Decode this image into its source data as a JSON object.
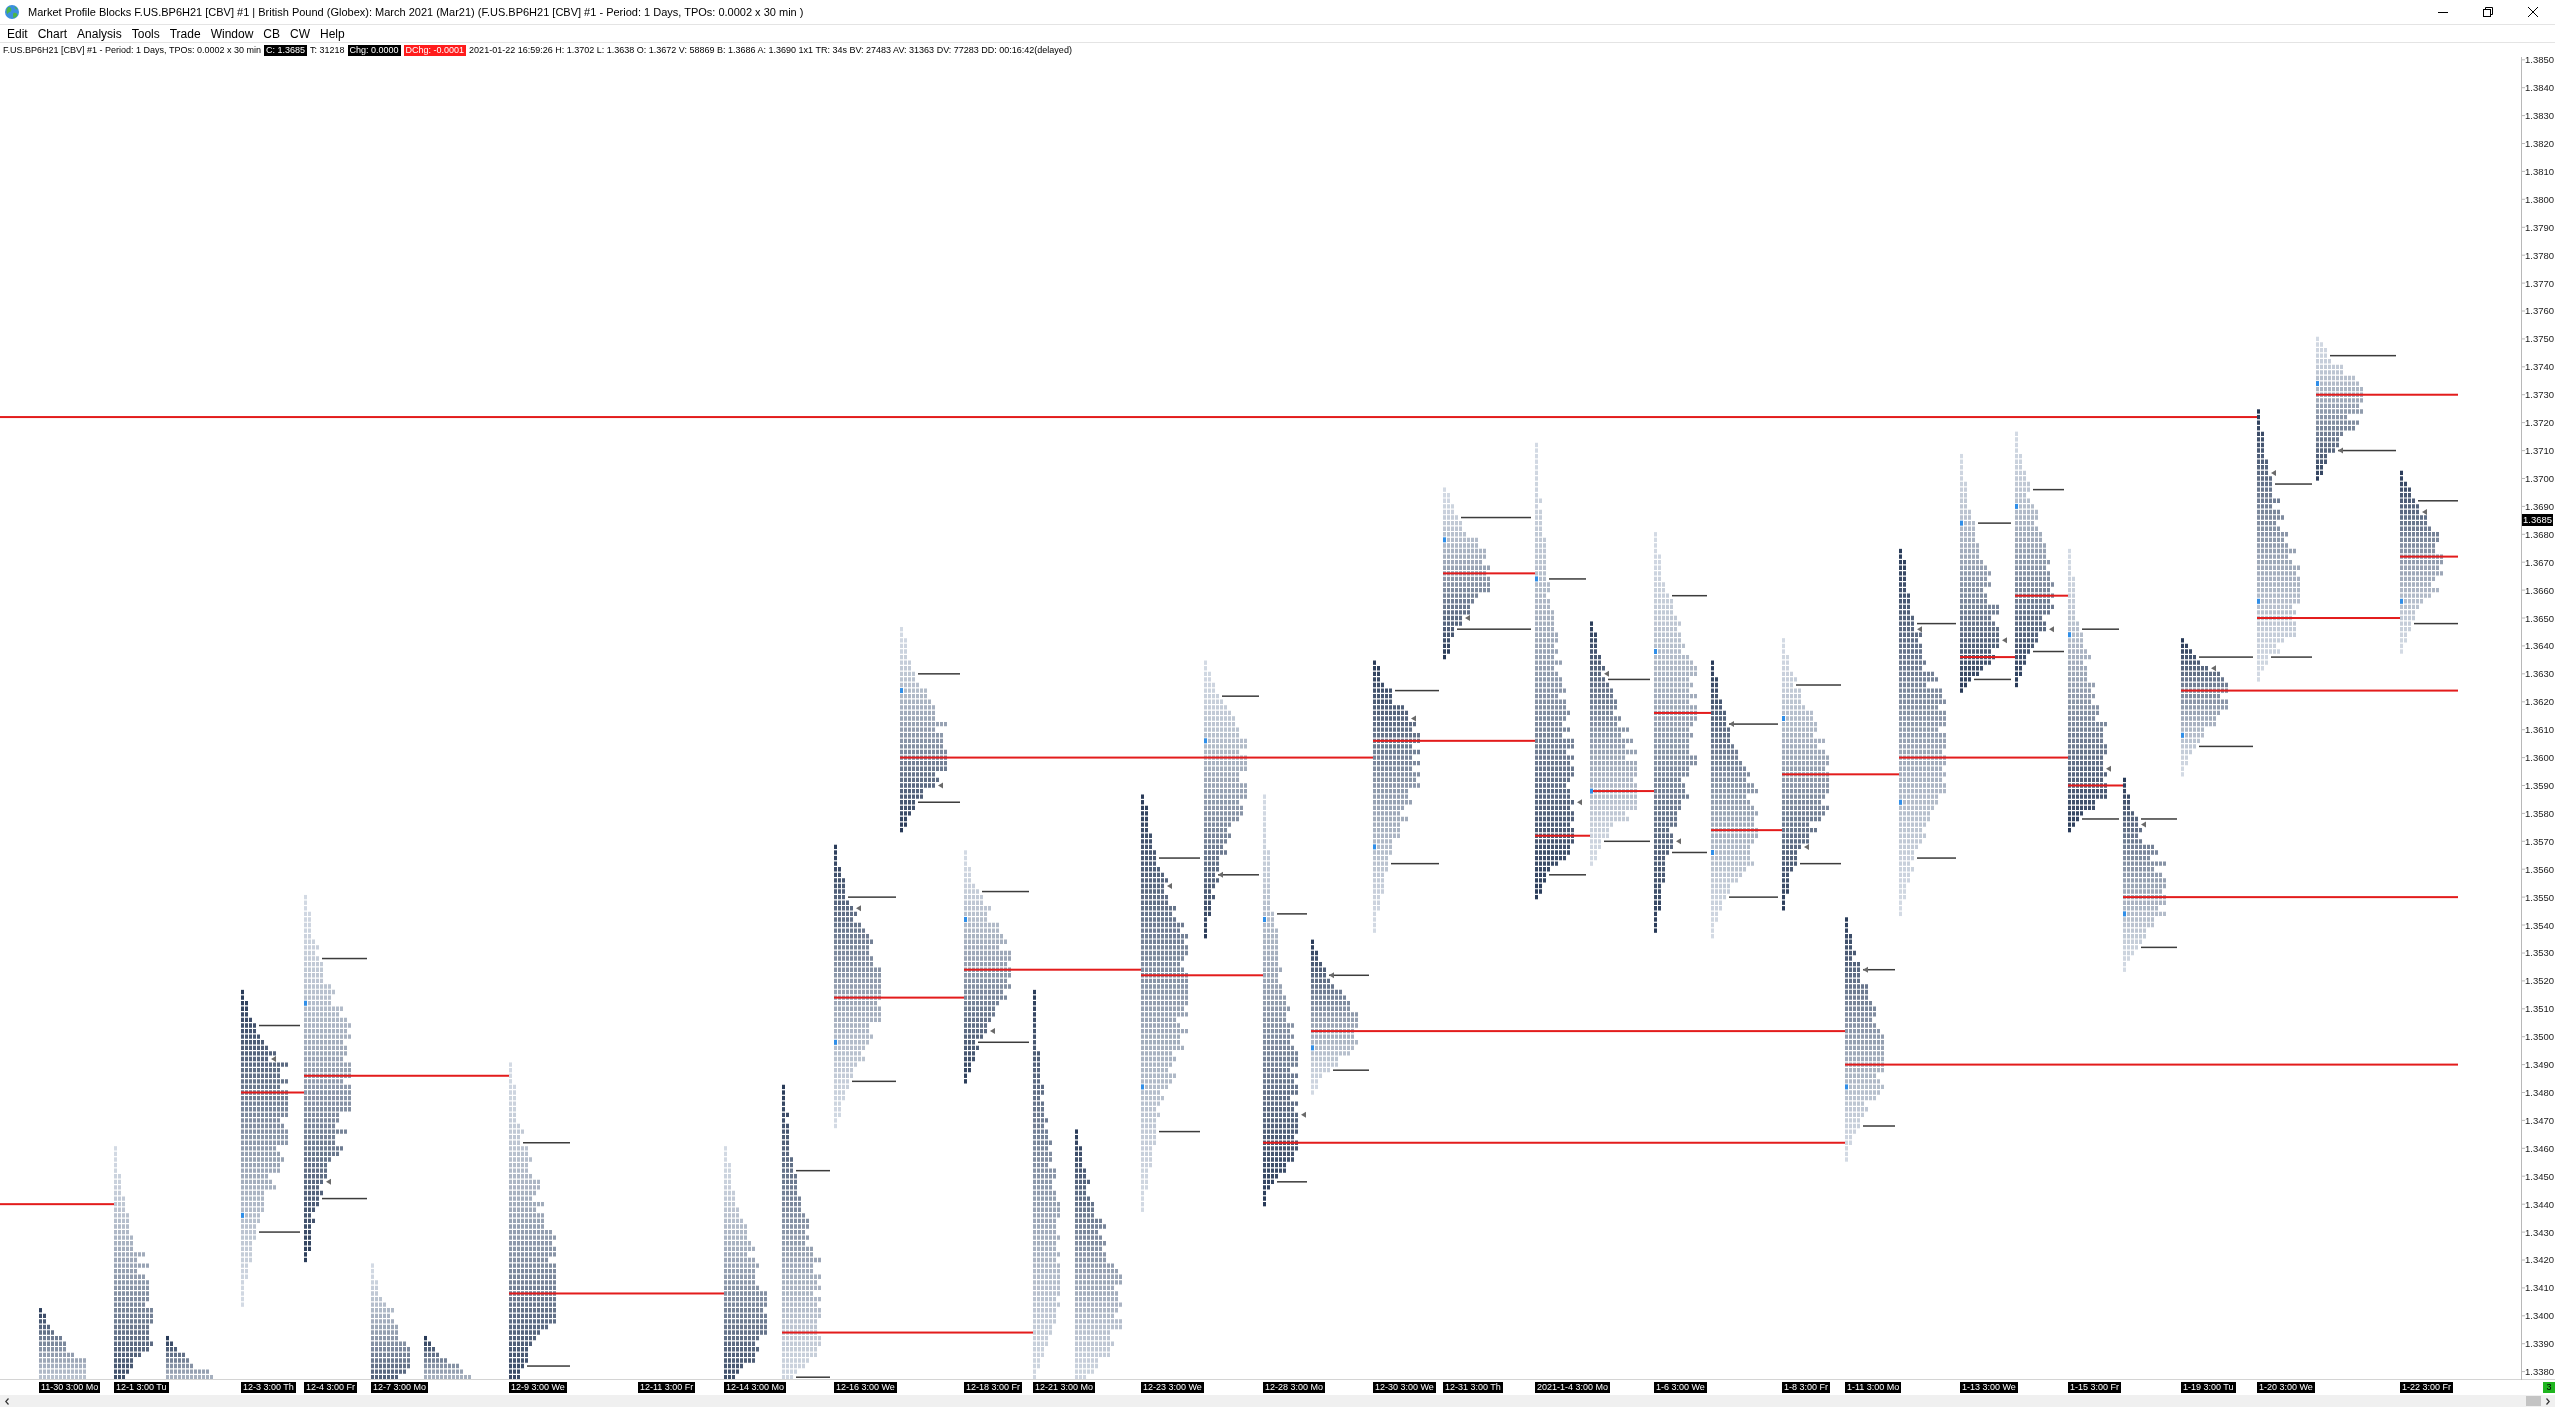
{
  "window": {
    "title": "Market Profile Blocks F.US.BP6H21 [CBV] #1 | British Pound (Globex): March 2021 (Mar21) (F.US.BP6H21 [CBV] #1 - Period: 1 Days, TPOs: 0.0002 x 30 min )"
  },
  "menu": [
    {
      "label": "Edit"
    },
    {
      "label": "Chart"
    },
    {
      "label": "Analysis"
    },
    {
      "label": "Tools"
    },
    {
      "label": "Trade"
    },
    {
      "label": "Window"
    },
    {
      "label": "CB"
    },
    {
      "label": "CW"
    },
    {
      "label": "Help"
    }
  ],
  "info_bar": [
    {
      "text": "F.US.BP6H21 [CBV] #1 - Period: 1 Days, TPOs: 0.0002 x 30 min",
      "kind": "plain"
    },
    {
      "text": "C: 1.3685",
      "kind": "inverse"
    },
    {
      "text": "T: 31218",
      "kind": "plain"
    },
    {
      "text": "Chg: 0.0000",
      "kind": "inverse"
    },
    {
      "text": "DChg: -0.0001",
      "kind": "alert"
    },
    {
      "text": "2021-01-22 16:59:26 H: 1.3702 L: 1.3638 O: 1.3672 V: 58869 B: 1.3686 A: 1.3690 1x1 TR: 34s BV: 27483 AV: 31363 DV: 77283 DD: 00:16:42(delayed)",
      "kind": "plain"
    }
  ],
  "chart": {
    "price_labels": [
      "1.3850",
      "1.3840",
      "1.3830",
      "1.3820",
      "1.3810",
      "1.3800",
      "1.3790",
      "1.3780",
      "1.3770",
      "1.3760",
      "1.3750",
      "1.3740",
      "1.3730",
      "1.3720",
      "1.3710",
      "1.3700",
      "1.3690",
      "1.3680",
      "1.3670",
      "1.3660",
      "1.3650",
      "1.3640",
      "1.3630",
      "1.3620",
      "1.3610",
      "1.3600",
      "1.3590",
      "1.3580",
      "1.3570",
      "1.3560",
      "1.3550",
      "1.3540",
      "1.3530",
      "1.3520",
      "1.3510",
      "1.3500",
      "1.3490",
      "1.3480",
      "1.3470",
      "1.3460",
      "1.3450",
      "1.3440",
      "1.3430",
      "1.3420",
      "1.3410",
      "1.3400",
      "1.3390",
      "1.3380"
    ],
    "last_price": "1.3685",
    "date_labels": [
      "11-30 3:00 Mo",
      "12-1 3:00 Tu",
      "12-3 3:00 Th",
      "12-4 3:00 Fr",
      "12-7 3:00 Mo",
      "12-9 3:00 We",
      "12-11 3:00 Fr",
      "12-14 3:00 Mo",
      "12-16 3:00 We",
      "12-18 3:00 Fr",
      "12-21 3:00 Mo",
      "12-23 3:00 We",
      "12-28 3:00 Mo",
      "12-30 3:00 We",
      "12-31 3:00 Th",
      "2021-1-4 3:00 Mo",
      "1-6 3:00 We",
      "1-8 3:00 Fr",
      "1-11 3:00 Mo",
      "1-13 3:00 We",
      "1-15 3:00 Fr",
      "1-19 3:00 Tu",
      "1-20 3:00 We",
      "1-22 3:00 Fr"
    ]
  },
  "status_indicator": {
    "text": "3"
  }
}
